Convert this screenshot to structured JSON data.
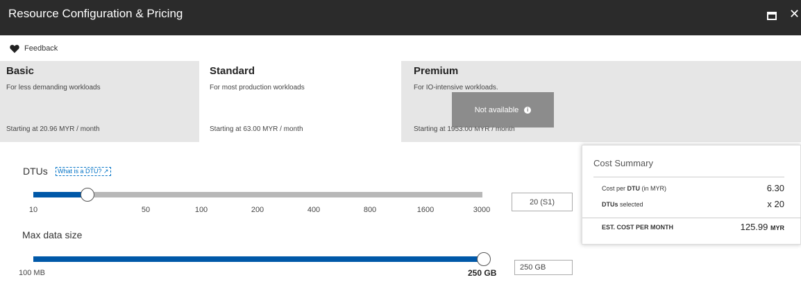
{
  "window": {
    "title": "Resource Configuration & Pricing",
    "maximize_icon": "maximize-icon",
    "close_glyph": "✕"
  },
  "feedback": {
    "label": "Feedback",
    "icon": "heart-icon"
  },
  "tiers": [
    {
      "name": "Basic",
      "description": "For less demanding workloads",
      "price": "Starting at 20.96 MYR / month",
      "selected": false
    },
    {
      "name": "Standard",
      "description": "For most production workloads",
      "price": "Starting at 63.00 MYR / month",
      "selected": true
    },
    {
      "name": "Premium",
      "description": "For IO-intensive workloads.",
      "price": "Starting at 1953.00 MYR / month",
      "selected": false
    }
  ],
  "premium_overlay": {
    "label": "Not available",
    "icon": "info-icon"
  },
  "dtu": {
    "label": "DTUs",
    "help_link": "What is a DTU? ↗",
    "ticks": [
      "10",
      "50",
      "100",
      "200",
      "400",
      "800",
      "1600",
      "3000"
    ],
    "selected_tick_index": 1,
    "selected_fraction": 0.12,
    "value": "20 (S1)"
  },
  "max_size": {
    "label": "Max data size",
    "min_label": "100 MB",
    "max_label": "250 GB",
    "selected_fraction": 1.0,
    "value": "250 GB"
  },
  "cost_summary": {
    "title": "Cost Summary",
    "cost_per_dtu_pre": "Cost per ",
    "cost_per_dtu_bold": "DTU",
    "cost_per_dtu_post": " (in MYR)",
    "cost_per_dtu_value": "6.30",
    "dtus_selected_bold": "DTUs",
    "dtus_selected_post": " selected",
    "dtus_selected_value": "x 20",
    "est_label": "EST. COST PER MONTH",
    "est_value": "125.99",
    "est_unit": "MYR"
  },
  "colors": {
    "titlebar": "#2b2b2b",
    "accent": "#0058a8",
    "tier_unselected": "#e6e6e6",
    "link": "#0072c6"
  }
}
